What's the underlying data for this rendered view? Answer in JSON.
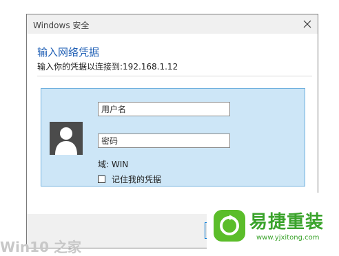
{
  "window": {
    "title": "Windows 安全",
    "close_icon": "close-icon"
  },
  "dialog": {
    "heading": "输入网络凭据",
    "subheading": "输入你的凭据以连接到:192.168.1.12"
  },
  "credentials": {
    "avatar_icon": "user-avatar-icon",
    "username_placeholder": "用户名",
    "password_placeholder": "密码",
    "domain_text": "域: WIN",
    "remember_label": "记住我的凭据",
    "remember_checked": false
  },
  "watermark": {
    "brand": "易捷重装",
    "url": "www.yjxitong.com"
  },
  "bottom_fragment": "Win10 之家",
  "colors": {
    "accent": "#1f5fb5",
    "panel_bg": "#cde6f7",
    "panel_border": "#6fb0de",
    "watermark_green": "#3aa32b"
  }
}
